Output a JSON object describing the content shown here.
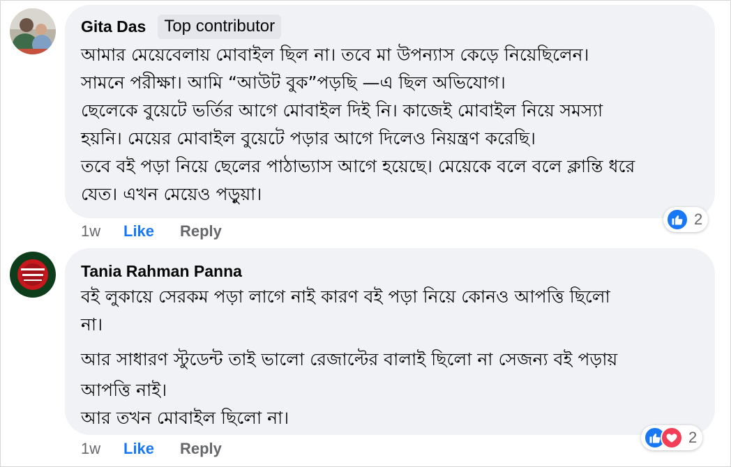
{
  "colors": {
    "bubble_bg": "#f0f2f5",
    "like_blue": "#1877f2",
    "love_red": "#f33e58",
    "muted_text": "#65676b"
  },
  "comments": [
    {
      "author": "Gita Das",
      "badge": "Top contributor",
      "lines": [
        "আমার মেয়েবেলায় মোবাইল ছিল না। তবে মা উপন্যাস কেড়ে নিয়েছিলেন।",
        "সামনে পরীক্ষা। আমি “আউট বুক”পড়ছি —এ ছিল অভিযোগ।",
        "ছেলেকে বুয়েটে ভর্তির আগে মোবাইল দিই নি। কাজেই মোবাইল নিয়ে সমস্যা",
        "হয়নি। মেয়ের মোবাইল বুয়েটে পড়ার আগে দিলেও নিয়ন্ত্রণ করেছি।",
        "তবে বই পড়া নিয়ে ছেলের পাঠাভ্যাস আগে হয়েছে। মেয়েকে বলে বলে ক্লান্তি ধরে",
        "যেত। এখন মেয়েও পড়ুয়া।"
      ],
      "time": "1w",
      "like_label": "Like",
      "reply_label": "Reply",
      "reaction_icons": [
        "like-icon"
      ],
      "reaction_count": "2"
    },
    {
      "author": "Tania Rahman Panna",
      "lines": [
        "বই লুকায়ে সেরকম পড়া লাগে নাই কারণ বই পড়া নিয়ে কোনও আপত্তি ছিলো",
        "না।",
        "আর সাধারণ স্টুডেন্ট তাই ভালো রেজাল্টের বালাই ছিলো না সেজন্য বই পড়ায়",
        "আপত্তি নাই।",
        "আর তখন মোবাইল ছিলো না।"
      ],
      "time": "1w",
      "like_label": "Like",
      "reply_label": "Reply",
      "reaction_icons": [
        "like-icon",
        "love-icon"
      ],
      "reaction_count": "2"
    }
  ]
}
